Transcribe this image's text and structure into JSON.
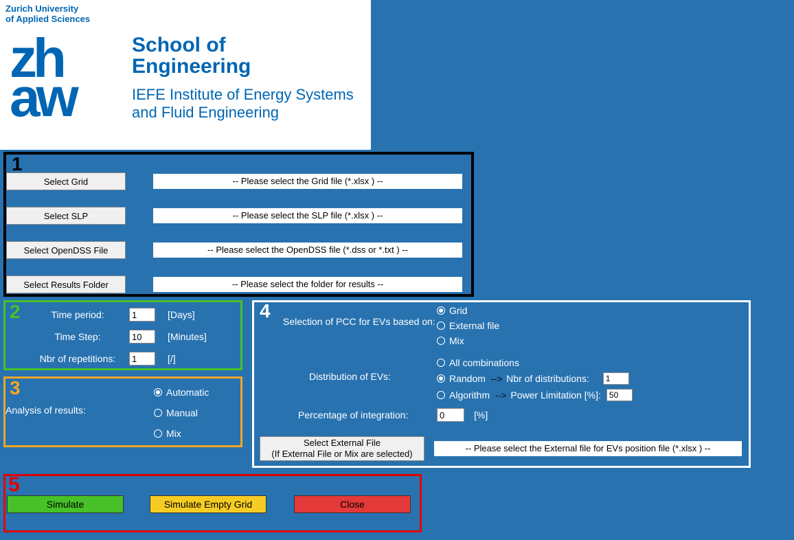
{
  "header": {
    "uni_line1": "Zurich University",
    "uni_line2": "of Applied Sciences",
    "logo_zh": "zh",
    "logo_aw": "aw",
    "school_line1": "School of",
    "school_line2": "Engineering",
    "inst_line1": "IEFE Institute of Energy Systems",
    "inst_line2": "and Fluid Engineering"
  },
  "panel1": {
    "num": "1",
    "rows": [
      {
        "btn": "Select Grid",
        "text": "-- Please select the Grid file (*.xlsx ) --"
      },
      {
        "btn": "Select SLP",
        "text": "-- Please select the SLP file (*.xlsx ) --"
      },
      {
        "btn": "Select OpenDSS File",
        "text": "-- Please select the OpenDSS file (*.dss or *.txt ) --"
      },
      {
        "btn": "Select Results Folder",
        "text": "-- Please select the folder for results --"
      }
    ]
  },
  "panel2": {
    "num": "2",
    "time_period_label": "Time period:",
    "time_period_value": "1",
    "time_period_unit": "[Days]",
    "time_step_label": "Time Step:",
    "time_step_value": "10",
    "time_step_unit": "[Minutes]",
    "reps_label": "Nbr of repetitions:",
    "reps_value": "1",
    "reps_unit": "[/]"
  },
  "panel3": {
    "num": "3",
    "label": "Analysis of results:",
    "opt1": "Automatic",
    "opt2": "Manual",
    "opt3": "Mix",
    "selected": "Automatic"
  },
  "panel4": {
    "num": "4",
    "pcc_label": "Selection of PCC for EVs based on:",
    "pcc_opt1": "Grid",
    "pcc_opt2": "External file",
    "pcc_opt3": "Mix",
    "pcc_selected": "Grid",
    "dist_label": "Distribution of EVs:",
    "dist_opt1": "All combinations",
    "dist_opt2": "Random",
    "dist_opt3": "Algorithm",
    "dist_selected": "Random",
    "nbr_dist_label": "Nbr of distributions:",
    "nbr_dist_value": "1",
    "power_lim_label": "Power Limitation [%]:",
    "power_lim_value": "50",
    "pct_label": "Percentage of integration:",
    "pct_value": "0",
    "pct_unit": "[%]",
    "ext_btn_line1": "Select External File",
    "ext_btn_line2": "(If External File or Mix are selected)",
    "ext_text": "-- Please select the External file for EVs position file (*.xlsx ) --"
  },
  "panel5": {
    "num": "5",
    "simulate": "Simulate",
    "simulate_empty": "Simulate Empty Grid",
    "close": "Close"
  }
}
